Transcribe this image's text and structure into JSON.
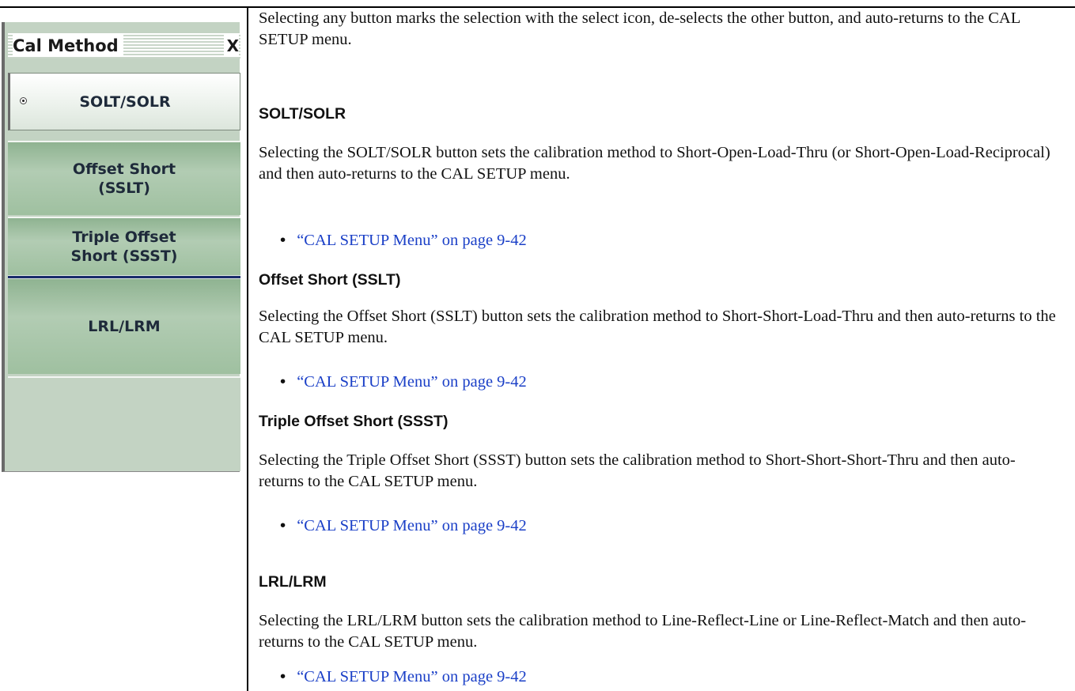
{
  "menu": {
    "title": "Cal Method",
    "close_label": "X",
    "buttons": [
      {
        "label": "SOLT/SOLR",
        "selected": true
      },
      {
        "label": "Offset Short\n(SSLT)",
        "line1": "Offset Short",
        "line2": "(SSLT)",
        "selected": false
      },
      {
        "label": "Triple Offset\nShort (SSST)",
        "line1": "Triple Offset",
        "line2": "Short (SSST)",
        "selected": false
      },
      {
        "label": "LRL/LRM",
        "selected": false
      }
    ]
  },
  "intro": "Selecting any button marks the selection with the select icon, de-selects the other button, and auto-returns to the CAL SETUP menu.",
  "sections": [
    {
      "heading": "SOLT/SOLR",
      "body": "Selecting the SOLT/SOLR button sets the calibration method to Short-Open-Load-Thru (or Short-Open-Load-Reciprocal) and then auto-returns to the CAL SETUP menu.",
      "link": "“CAL SETUP Menu” on page 9-42"
    },
    {
      "heading": "Offset Short (SSLT)",
      "body": "Selecting the Offset Short (SSLT) button sets the calibration method to Short-Short-Load-Thru and then auto-returns to the CAL SETUP menu.",
      "link": "“CAL SETUP Menu” on page 9-42"
    },
    {
      "heading": "Triple Offset Short (SSST)",
      "body": "Selecting the Triple Offset Short (SSST) button sets the calibration method to Short-Short-Short-Thru and then auto-returns to the CAL SETUP menu.",
      "link": "“CAL SETUP Menu” on page 9-42"
    },
    {
      "heading": "LRL/LRM",
      "body": "Selecting the LRL/LRM button sets the calibration method to Line-Reflect-Line or Line-Reflect-Match and then auto-returns to the CAL SETUP menu.",
      "link": "“CAL SETUP Menu” on page 9-42"
    }
  ],
  "colors": {
    "link": "#1a3fc7",
    "panel_bg": "#c3d3c3",
    "separator_blue": "#1a2c6b"
  }
}
